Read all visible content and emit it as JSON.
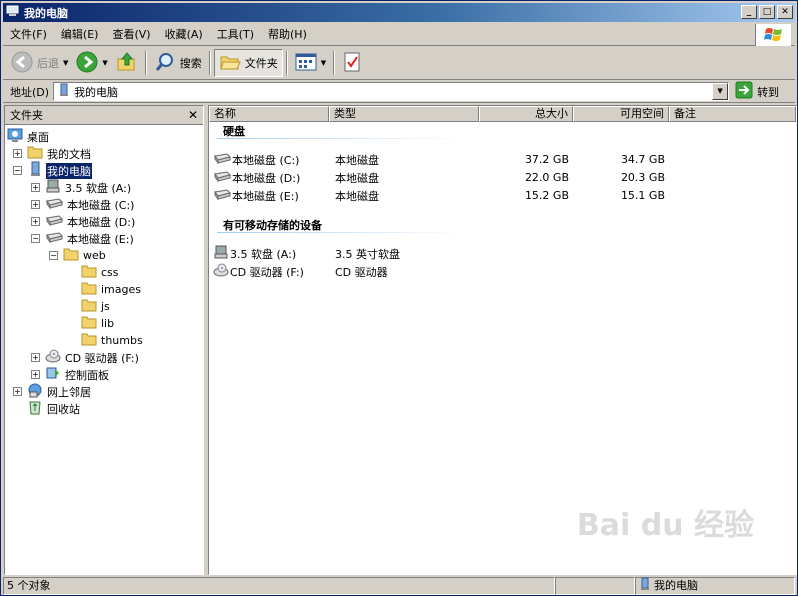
{
  "window": {
    "title": "我的电脑"
  },
  "menu": [
    "文件(F)",
    "编辑(E)",
    "查看(V)",
    "收藏(A)",
    "工具(T)",
    "帮助(H)"
  ],
  "toolbar": {
    "back": "后退",
    "search": "搜索",
    "folders": "文件夹"
  },
  "address": {
    "label": "地址(D)",
    "value": "我的电脑",
    "go": "转到"
  },
  "folders_pane": {
    "title": "文件夹",
    "tree": [
      {
        "label": "桌面",
        "icon": "desktop-icon",
        "level": 0,
        "expander": ""
      },
      {
        "label": "我的文档",
        "icon": "folder-icon",
        "level": 1,
        "expander": "+"
      },
      {
        "label": "我的电脑",
        "icon": "computer-icon",
        "level": 1,
        "expander": "-",
        "selected": true
      },
      {
        "label": "3.5 软盘 (A:)",
        "icon": "floppy-icon",
        "level": 2,
        "expander": "+"
      },
      {
        "label": "本地磁盘 (C:)",
        "icon": "drive-icon",
        "level": 2,
        "expander": "+"
      },
      {
        "label": "本地磁盘 (D:)",
        "icon": "drive-icon",
        "level": 2,
        "expander": "+"
      },
      {
        "label": "本地磁盘 (E:)",
        "icon": "drive-icon",
        "level": 2,
        "expander": "-"
      },
      {
        "label": "web",
        "icon": "folder-icon",
        "level": 3,
        "expander": "-"
      },
      {
        "label": "css",
        "icon": "folder-icon",
        "level": 4,
        "expander": ""
      },
      {
        "label": "images",
        "icon": "folder-icon",
        "level": 4,
        "expander": ""
      },
      {
        "label": "js",
        "icon": "folder-icon",
        "level": 4,
        "expander": ""
      },
      {
        "label": "lib",
        "icon": "folder-icon",
        "level": 4,
        "expander": ""
      },
      {
        "label": "thumbs",
        "icon": "folder-icon",
        "level": 4,
        "expander": ""
      },
      {
        "label": "CD 驱动器 (F:)",
        "icon": "cd-icon",
        "level": 2,
        "expander": "+"
      },
      {
        "label": "控制面板",
        "icon": "control-panel-icon",
        "level": 2,
        "expander": "+"
      },
      {
        "label": "网上邻居",
        "icon": "network-icon",
        "level": 1,
        "expander": "+"
      },
      {
        "label": "回收站",
        "icon": "recycle-bin-icon",
        "level": 1,
        "expander": ""
      }
    ]
  },
  "columns": {
    "name": "名称",
    "type": "类型",
    "total": "总大小",
    "free": "可用空间",
    "notes": "备注"
  },
  "groups": [
    {
      "title": "硬盘",
      "items": [
        {
          "name": "本地磁盘 (C:)",
          "type": "本地磁盘",
          "total": "37.2 GB",
          "free": "34.7 GB",
          "icon": "drive-icon"
        },
        {
          "name": "本地磁盘 (D:)",
          "type": "本地磁盘",
          "total": "22.0 GB",
          "free": "20.3 GB",
          "icon": "drive-icon"
        },
        {
          "name": "本地磁盘 (E:)",
          "type": "本地磁盘",
          "total": "15.2 GB",
          "free": "15.1 GB",
          "icon": "drive-icon"
        }
      ]
    },
    {
      "title": "有可移动存储的设备",
      "items": [
        {
          "name": "3.5 软盘 (A:)",
          "type": "3.5 英寸软盘",
          "total": "",
          "free": "",
          "icon": "floppy-icon"
        },
        {
          "name": "CD 驱动器 (F:)",
          "type": "CD 驱动器",
          "total": "",
          "free": "",
          "icon": "cd-icon"
        }
      ]
    }
  ],
  "status": {
    "count": "5 个对象",
    "location": "我的电脑"
  },
  "watermark": "Bai du 经验"
}
